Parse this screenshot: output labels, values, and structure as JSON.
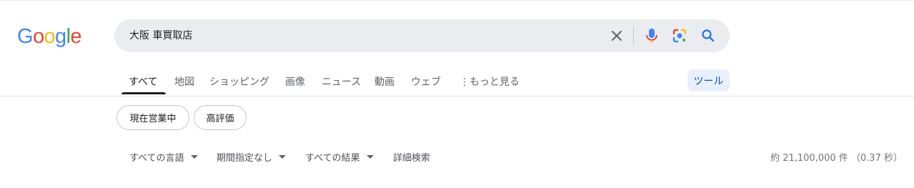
{
  "logo": {
    "letters": [
      {
        "char": "G",
        "color": "#4285F4"
      },
      {
        "char": "o",
        "color": "#EA4335"
      },
      {
        "char": "o",
        "color": "#FBBC05"
      },
      {
        "char": "g",
        "color": "#4285F4"
      },
      {
        "char": "l",
        "color": "#34A853"
      },
      {
        "char": "e",
        "color": "#EA4335"
      }
    ]
  },
  "search": {
    "query": "大阪 車買取店",
    "icons": [
      "close-icon",
      "mic-icon",
      "lens-icon",
      "search-icon"
    ]
  },
  "tabs": [
    {
      "label": "すべて",
      "active": true
    },
    {
      "label": "地図"
    },
    {
      "label": "ショッピング"
    },
    {
      "label": "画像"
    },
    {
      "label": "ニュース"
    },
    {
      "label": "動画"
    },
    {
      "label": "ウェブ"
    },
    {
      "label": "もっと見る"
    }
  ],
  "tools_label": "ツール",
  "chips": [
    "現在営業中",
    "高評価"
  ],
  "filters": [
    {
      "label": "すべての言語",
      "dropdown": true
    },
    {
      "label": "期間指定なし",
      "dropdown": true
    },
    {
      "label": "すべての結果",
      "dropdown": true
    },
    {
      "label": "詳細検索",
      "dropdown": false
    }
  ],
  "result_stats": "約 21,100,000 件 （0.37 秒）",
  "colors": {
    "accent_blue": "#1a73e8",
    "tools_bg": "#e8f0fe",
    "tools_text": "#174ea6",
    "searchbar_bg": "#eaecef"
  }
}
